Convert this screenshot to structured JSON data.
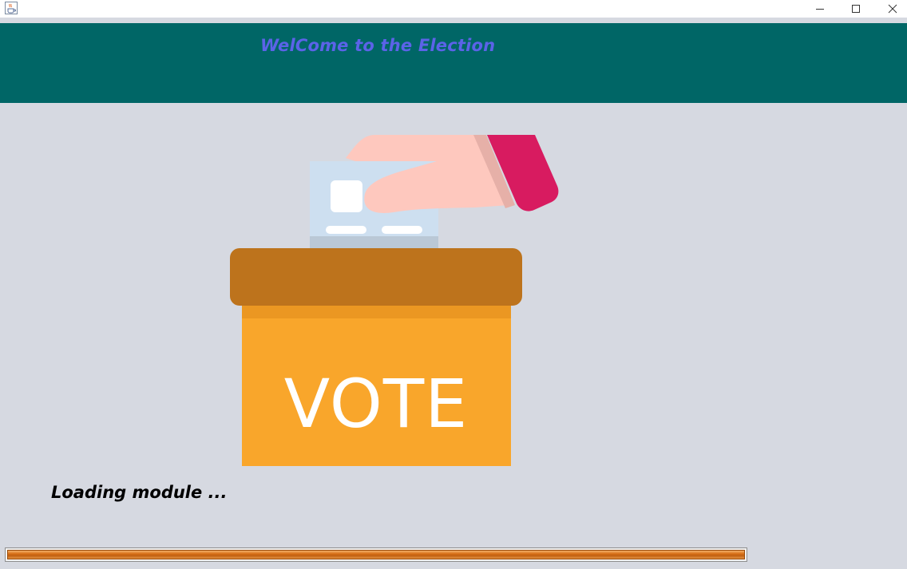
{
  "window": {
    "icon": "java-cup-icon",
    "controls": [
      "minimize-icon",
      "maximize-icon",
      "close-icon"
    ]
  },
  "header": {
    "title": "WelCome to the Election",
    "background": "#006666",
    "title_color": "#5b63e8"
  },
  "illustration": {
    "icon": "ballot-box-icon",
    "box_label": "VOTE",
    "colors": {
      "box": "#f9a62b",
      "lid": "#bd731c",
      "hand": "#fec8be",
      "sleeve": "#d81b60",
      "card": "#cddff0"
    }
  },
  "status": {
    "loading_text": "Loading module ..."
  },
  "progress": {
    "value_percent": 100,
    "fill_color": "#d86f16"
  }
}
